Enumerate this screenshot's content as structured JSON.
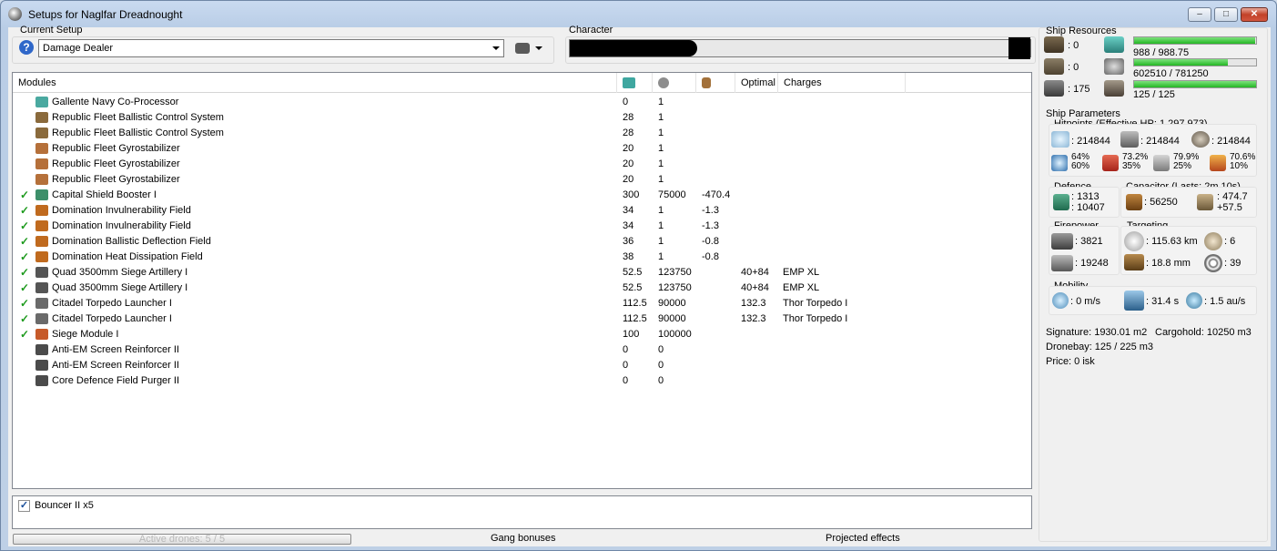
{
  "window": {
    "title": "Setups for Naglfar Dreadnought"
  },
  "setup": {
    "label": "Current Setup",
    "selected": "Damage Dealer"
  },
  "character": {
    "label": "Character"
  },
  "modules": {
    "columns": [
      "Modules",
      "cpu-icon",
      "power-icon",
      "capacitor-icon",
      "Optimal",
      "Charges"
    ],
    "header_label": "Modules",
    "optimal_label": "Optimal",
    "charges_label": "Charges",
    "rows": [
      {
        "name": "Gallente Navy Co-Processor",
        "active": false,
        "icon": "coprocessor-icon",
        "color": "#4aa9a0",
        "cpu": "0",
        "pg": "1",
        "cap": "",
        "optimal": "",
        "charges": ""
      },
      {
        "name": "Republic Fleet Ballistic Control System",
        "active": false,
        "icon": "ballistic-control-icon",
        "color": "#8a6a3c",
        "cpu": "28",
        "pg": "1",
        "cap": "",
        "optimal": "",
        "charges": ""
      },
      {
        "name": "Republic Fleet Ballistic Control System",
        "active": false,
        "icon": "ballistic-control-icon",
        "color": "#8a6a3c",
        "cpu": "28",
        "pg": "1",
        "cap": "",
        "optimal": "",
        "charges": ""
      },
      {
        "name": "Republic Fleet Gyrostabilizer",
        "active": false,
        "icon": "gyrostabilizer-icon",
        "color": "#b5703a",
        "cpu": "20",
        "pg": "1",
        "cap": "",
        "optimal": "",
        "charges": ""
      },
      {
        "name": "Republic Fleet Gyrostabilizer",
        "active": false,
        "icon": "gyrostabilizer-icon",
        "color": "#b5703a",
        "cpu": "20",
        "pg": "1",
        "cap": "",
        "optimal": "",
        "charges": ""
      },
      {
        "name": "Republic Fleet Gyrostabilizer",
        "active": false,
        "icon": "gyrostabilizer-icon",
        "color": "#b5703a",
        "cpu": "20",
        "pg": "1",
        "cap": "",
        "optimal": "",
        "charges": ""
      },
      {
        "name": "Capital Shield Booster I",
        "active": true,
        "icon": "shield-booster-icon",
        "color": "#3d8f6a",
        "cpu": "300",
        "pg": "75000",
        "cap": "-470.4",
        "optimal": "",
        "charges": ""
      },
      {
        "name": "Domination Invulnerability Field",
        "active": true,
        "icon": "invulnerability-field-icon",
        "color": "#c06a1e",
        "cpu": "34",
        "pg": "1",
        "cap": "-1.3",
        "optimal": "",
        "charges": ""
      },
      {
        "name": "Domination Invulnerability Field",
        "active": true,
        "icon": "invulnerability-field-icon",
        "color": "#c06a1e",
        "cpu": "34",
        "pg": "1",
        "cap": "-1.3",
        "optimal": "",
        "charges": ""
      },
      {
        "name": "Domination Ballistic Deflection Field",
        "active": true,
        "icon": "deflection-field-icon",
        "color": "#c06a1e",
        "cpu": "36",
        "pg": "1",
        "cap": "-0.8",
        "optimal": "",
        "charges": ""
      },
      {
        "name": "Domination Heat Dissipation Field",
        "active": true,
        "icon": "dissipation-field-icon",
        "color": "#c06a1e",
        "cpu": "38",
        "pg": "1",
        "cap": "-0.8",
        "optimal": "",
        "charges": ""
      },
      {
        "name": "Quad 3500mm Siege Artillery I",
        "active": true,
        "icon": "artillery-icon",
        "color": "#555555",
        "cpu": "52.5",
        "pg": "123750",
        "cap": "",
        "optimal": "40+84",
        "charges": "EMP XL"
      },
      {
        "name": "Quad 3500mm Siege Artillery I",
        "active": true,
        "icon": "artillery-icon",
        "color": "#555555",
        "cpu": "52.5",
        "pg": "123750",
        "cap": "",
        "optimal": "40+84",
        "charges": "EMP XL"
      },
      {
        "name": "Citadel Torpedo Launcher I",
        "active": true,
        "icon": "torpedo-launcher-icon",
        "color": "#6a6a6a",
        "cpu": "112.5",
        "pg": "90000",
        "cap": "",
        "optimal": "132.3",
        "charges": "Thor Torpedo I"
      },
      {
        "name": "Citadel Torpedo Launcher I",
        "active": true,
        "icon": "torpedo-launcher-icon",
        "color": "#6a6a6a",
        "cpu": "112.5",
        "pg": "90000",
        "cap": "",
        "optimal": "132.3",
        "charges": "Thor Torpedo I"
      },
      {
        "name": "Siege Module I",
        "active": true,
        "icon": "siege-module-icon",
        "color": "#c65a2a",
        "cpu": "100",
        "pg": "100000",
        "cap": "",
        "optimal": "",
        "charges": ""
      },
      {
        "name": "Anti-EM Screen Reinforcer II",
        "active": false,
        "icon": "rig-icon",
        "color": "#4b4b4b",
        "cpu": "0",
        "pg": "0",
        "cap": "",
        "optimal": "",
        "charges": ""
      },
      {
        "name": "Anti-EM Screen Reinforcer II",
        "active": false,
        "icon": "rig-icon",
        "color": "#4b4b4b",
        "cpu": "0",
        "pg": "0",
        "cap": "",
        "optimal": "",
        "charges": ""
      },
      {
        "name": "Core Defence Field Purger II",
        "active": false,
        "icon": "rig-icon",
        "color": "#4b4b4b",
        "cpu": "0",
        "pg": "0",
        "cap": "",
        "optimal": "",
        "charges": ""
      }
    ]
  },
  "drones": {
    "item": "Bouncer II x5",
    "checked": true
  },
  "statusbar": {
    "active_drones": "Active drones: 5 / 5",
    "drones_fraction": 0,
    "gang": "Gang bonuses",
    "projected": "Projected effects"
  },
  "resources": {
    "label": "Ship Resources",
    "turret_hardpoints": ": 0",
    "launcher_hardpoints": ": 0",
    "calibration": ": 175",
    "cpu": "988 / 988.75",
    "cpu_fraction": 0.99,
    "powergrid": "602510 / 781250",
    "powergrid_fraction": 0.77,
    "drone_bandwidth": "125 / 125",
    "drone_fraction": 1.0
  },
  "params": {
    "label": "Ship Parameters",
    "hitpoints_label": "Hitpoints (Effective HP: 1,297,973)",
    "shield_hp": ": 214844",
    "armor_hp": ": 214844",
    "structure_hp": ": 214844",
    "res1_top": "64%",
    "res1_bot": "60%",
    "res2_top": "73.2%",
    "res2_bot": "35%",
    "res3_top": "79.9%",
    "res3_bot": "25%",
    "res4_top": "70.6%",
    "res4_bot": "10%",
    "defence_label": "Defence",
    "def_top": ": 1313",
    "def_bot": ": 10407",
    "capacitor_label": "Capacitor (Lasts: 2m 10s)",
    "cap_amount": ": 56250",
    "cap_top": ": 474.7",
    "cap_bot": "+57.5",
    "firepower_label": "Firepower",
    "fp_top": ": 3821",
    "fp_bot": ": 19248",
    "targeting_label": "Targeting",
    "range": ": 115.63 km",
    "targets": ": 6",
    "resolution": ": 18.8 mm",
    "sensor": ": 39",
    "mobility_label": "Mobility",
    "speed": ": 0 m/s",
    "align": ": 31.4 s",
    "warp": ": 1.5 au/s",
    "signature": "Signature: 1930.01 m2",
    "cargohold": "Cargohold: 10250 m3",
    "dronebay": "Dronebay: 125 / 225 m3",
    "price": "Price: 0 isk"
  }
}
